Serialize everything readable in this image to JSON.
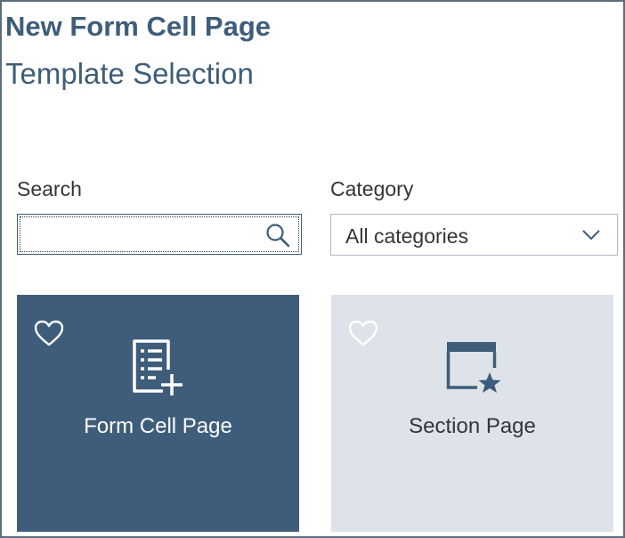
{
  "header": {
    "title": "New Form Cell Page",
    "subtitle": "Template Selection"
  },
  "search": {
    "label": "Search",
    "value": "",
    "placeholder": ""
  },
  "category": {
    "label": "Category",
    "selected": "All categories"
  },
  "templates": [
    {
      "label": "Form Cell Page",
      "icon": "form-add-icon",
      "favorite": false,
      "selected": true,
      "colors": {
        "background": "#3e5d7a",
        "foreground": "#ffffff"
      }
    },
    {
      "label": "Section Page",
      "icon": "calendar-star-icon",
      "favorite": false,
      "selected": false,
      "colors": {
        "background": "#dde3e8",
        "foreground": "#32363a",
        "icon": "#3e5d7a"
      }
    }
  ],
  "colors": {
    "accent": "#3e5d7a",
    "text": "#32363a",
    "border": "#b0b8bf"
  }
}
